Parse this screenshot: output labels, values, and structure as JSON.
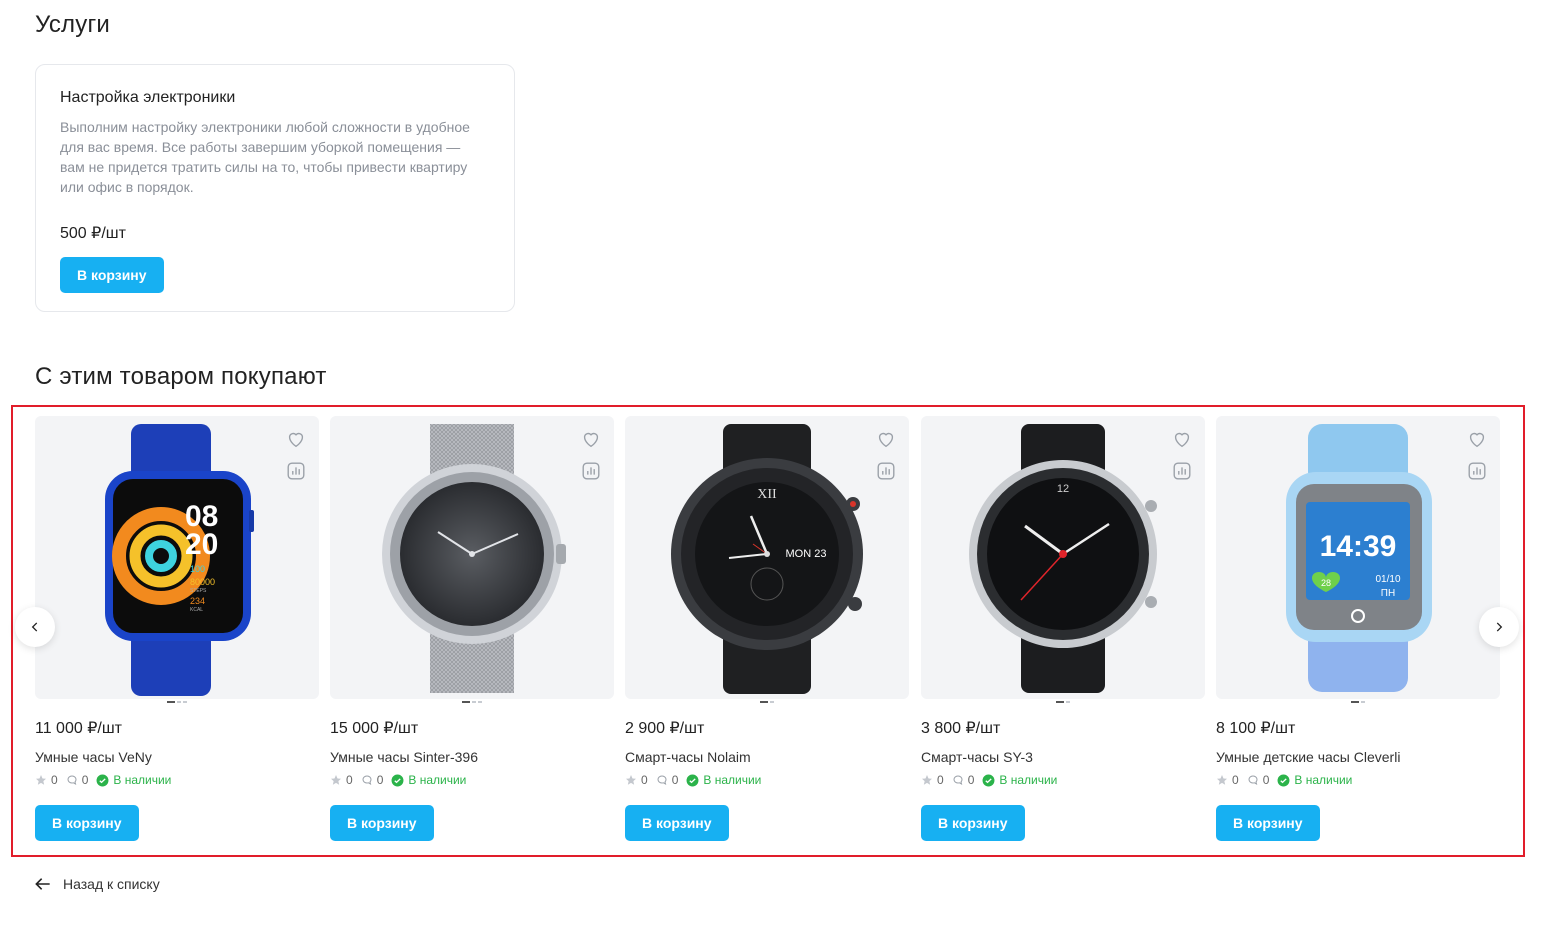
{
  "services": {
    "title": "Услуги",
    "card": {
      "name": "Настройка электроники",
      "description": "Выполним настройку электроники любой сложности в удобное для вас время. Все работы завершим уборкой помещения — вам не придется тратить силы на то, чтобы привести квартиру или офис в порядок.",
      "price": "500 ₽/шт",
      "button": "В корзину"
    }
  },
  "related": {
    "title": "С этим товаром покупают",
    "products": [
      {
        "price": "11 000 ₽/шт",
        "name": "Умные часы VeNy",
        "rating": "0",
        "reviews": "0",
        "stock": "В наличии",
        "button": "В корзину",
        "image": "blue-square-smartwatch"
      },
      {
        "price": "15 000 ₽/шт",
        "name": "Умные часы Sinter-396",
        "rating": "0",
        "reviews": "0",
        "stock": "В наличии",
        "button": "В корзину",
        "image": "silver-mesh-watch"
      },
      {
        "price": "2 900 ₽/шт",
        "name": "Смарт-часы Nolaim",
        "rating": "0",
        "reviews": "0",
        "stock": "В наличии",
        "button": "В корзину",
        "image": "black-round-smartwatch"
      },
      {
        "price": "3 800 ₽/шт",
        "name": "Смарт-часы SY-3",
        "rating": "0",
        "reviews": "0",
        "stock": "В наличии",
        "button": "В корзину",
        "image": "steel-round-smartwatch"
      },
      {
        "price": "8 100 ₽/шт",
        "name": "Умные детские часы Cleverli",
        "rating": "0",
        "reviews": "0",
        "stock": "В наличии",
        "button": "В корзину",
        "image": "kids-blue-smartwatch"
      }
    ],
    "prev_icon": "chevron-left-icon",
    "next_icon": "chevron-right-icon"
  },
  "back_link": "Назад к списку",
  "watch_faces": {
    "veny": {
      "hours": "08",
      "minutes": "20",
      "steps_value": "80000",
      "steps_unit": "STEPS",
      "kcal_value": "234",
      "kcal_unit": "KCAL",
      "pct": "100"
    },
    "nolaim": {
      "date": "MON 23",
      "roman": "XII"
    },
    "sy3": {
      "twelve": "12"
    },
    "cleverli": {
      "time": "14:39",
      "date": "01/10",
      "day": "ПН",
      "badge": "28"
    }
  },
  "colors": {
    "accent": "#17b0f2",
    "stock": "#2bb34a",
    "highlight": "#e11d2a"
  }
}
